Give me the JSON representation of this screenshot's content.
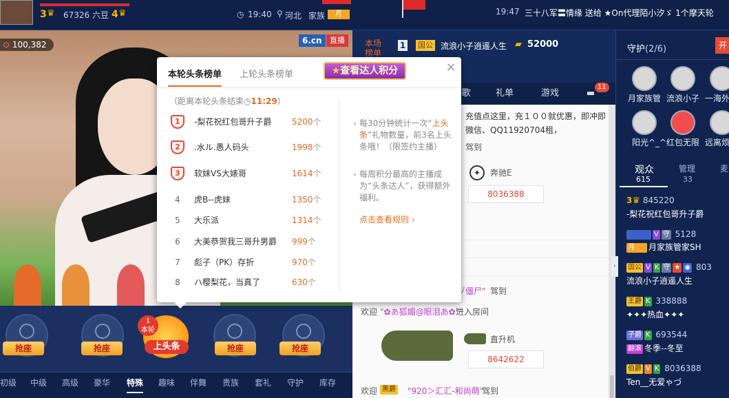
{
  "topbar": {
    "level1": "3",
    "beans": "67326 六豆",
    "level2": "4",
    "time": "19:40",
    "location": "河北",
    "family_label": "家族",
    "family_badge": "月",
    "right_time": "19:47",
    "broadcast": "三十八军〓情缘 送给 ★On代理陌小汐ゞ 1个摩天轮"
  },
  "video": {
    "viewers": "100,382",
    "logo": "6.cn",
    "live_label": "直播"
  },
  "seats": {
    "seat_label": "抢座",
    "headline_round": "本轮",
    "headline_text": "上头条",
    "headline_rank": "1"
  },
  "gift_tabs": [
    "初级",
    "中级",
    "高级",
    "豪华",
    "特殊",
    "趣味",
    "伴舞",
    "贵族",
    "套礼",
    "守护",
    "库存"
  ],
  "gift_tab_active": "特殊",
  "rank_bar": {
    "label": "本场榜单",
    "rank": "1",
    "badge": "国公",
    "name": "流浪小子逍遥人生",
    "score": "52000"
  },
  "mid_tabs": [
    "歌",
    "礼单",
    "游戏"
  ],
  "mid_tab_car_count": "11",
  "chat": {
    "promo_line1": "充值点这里，充１００就优惠，即冲即",
    "promo_line2": "微信、QQ11920704租，",
    "arrive1": "驾到",
    "gift1_name": "奔驰E",
    "gift1_value": "8036388",
    "arrive2_user": "ゾ僵尸\"",
    "arrive2_suffix": "驾到",
    "welcome_prefix": "欢迎",
    "welcome_user": "\"✿あ狐媚@眼泪あ✿\"",
    "welcome_suffix": "进入房间",
    "gift2_name": "直升机",
    "gift2_value": "8642622",
    "bottom_prefix": "欢迎",
    "bottom_badge": "黑爵",
    "bottom_user": "\"920＞汇汇-和尚萌\"",
    "bottom_suffix": "驾到"
  },
  "right": {
    "guard_title": "守护",
    "guard_count": "(2/6)",
    "guard_btn": "开",
    "guards": [
      "月家族管",
      "流浪小子",
      "一海外",
      "阳光^_^",
      "红包无限",
      "远离烦"
    ],
    "aud_tab": "观众",
    "aud_count": "615",
    "mgr_tab": "管理",
    "mgr_count": "33",
    "third_tab": "麦",
    "users": [
      {
        "level": "3",
        "id": "845220",
        "name": "-梨花祝红包哥升子爵"
      },
      {
        "level": "",
        "id": "5128",
        "name": "月家族管家SH"
      },
      {
        "level": "",
        "id": "803",
        "name": "流浪小子逍遥人生"
      },
      {
        "level": "",
        "id": "338888",
        "name": "✦✦✦热血✦✦✦"
      },
      {
        "level": "",
        "id": "693544",
        "name": "冬季--冬至"
      },
      {
        "level": "",
        "id": "8036388",
        "name": "Ten__无爱ゃづ"
      }
    ],
    "badge_guo": "国公",
    "badge_wang": "王爵",
    "badge_zi": "子爵",
    "badge_bo": "伯爵",
    "badge_fan": "翻滚",
    "badge_yue": "月"
  },
  "popup": {
    "tab_current": "本轮头条榜单",
    "tab_last": "上轮头条榜单",
    "tab_expert": "查看达人积分",
    "countdown_label": "距离本轮头条结束",
    "countdown_time": "11:29",
    "rows": [
      {
        "rank": "1",
        "name": "-梨花祝红包哥升子爵",
        "value": "5200"
      },
      {
        "rank": "2",
        "name": ".水ル.愚人码头",
        "value": "1998"
      },
      {
        "rank": "3",
        "name": "软妹VS大婊哥",
        "value": "1614"
      },
      {
        "rank": "4",
        "name": "虎B--虎妹",
        "value": "1350"
      },
      {
        "rank": "5",
        "name": "大乐派",
        "value": "1314"
      },
      {
        "rank": "6",
        "name": "大美恭贺我三哥升男爵",
        "value": "999"
      },
      {
        "rank": "7",
        "name": "彪子（PK）存折",
        "value": "970"
      },
      {
        "rank": "8",
        "name": "ハ樱梨花，当真了",
        "value": "630"
      }
    ],
    "unit": "个",
    "info1_a": "每30分钟统计一次",
    "info1_hl": "上头条",
    "info1_b": "礼物数量，前3名上头条哦！",
    "info1_c": "（限签约主播）",
    "info2_a": "每周积分最高的主播成为",
    "info2_hl": "头条达人",
    "info2_b": "，获得额外福利。",
    "rule_link": "点击查看规则"
  }
}
